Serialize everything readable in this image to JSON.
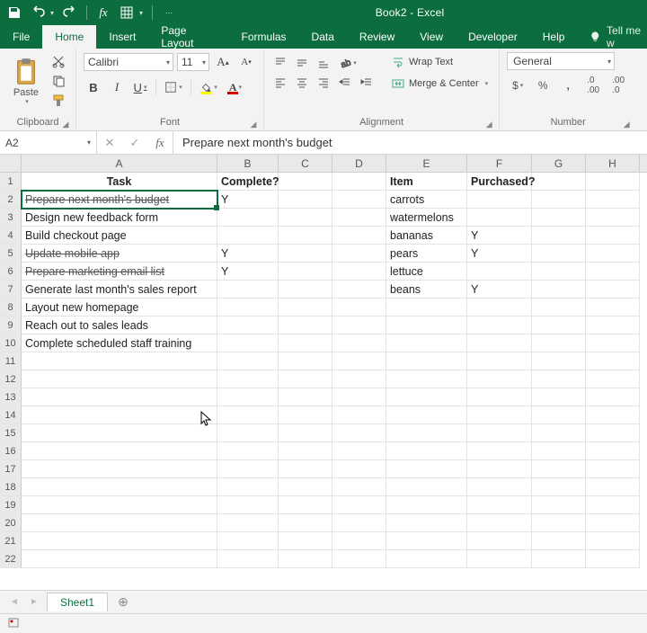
{
  "app": {
    "title": "Book2  -  Excel"
  },
  "qat_icons": [
    "save-icon",
    "undo-icon",
    "redo-icon",
    "fx-icon",
    "touch-icon"
  ],
  "tabs": [
    "File",
    "Home",
    "Insert",
    "Page Layout",
    "Formulas",
    "Data",
    "Review",
    "View",
    "Developer",
    "Help"
  ],
  "tabs_active_index": 1,
  "tellme": "Tell me w",
  "ribbon": {
    "clipboard_label": "Clipboard",
    "paste_label": "Paste",
    "font_label": "Font",
    "font_name": "Calibri",
    "font_size": "11",
    "alignment_label": "Alignment",
    "wrap_text": "Wrap Text",
    "merge_center": "Merge & Center",
    "number_label": "Number",
    "number_format": "General"
  },
  "formula_bar": {
    "name_box": "A2",
    "formula": "Prepare next month's budget"
  },
  "columns": [
    "A",
    "B",
    "C",
    "D",
    "E",
    "F",
    "G",
    "H"
  ],
  "rows": [
    1,
    2,
    3,
    4,
    5,
    6,
    7,
    8,
    9,
    10,
    11,
    12,
    13,
    14,
    15,
    16,
    17,
    18,
    19,
    20,
    21,
    22
  ],
  "cells": {
    "A1": "Task",
    "B1": "Complete?",
    "E1": "Item",
    "F1": "Purchased?",
    "A2": "Prepare next month's budget",
    "B2": "Y",
    "E2": "carrots",
    "A3": "Design new feedback form",
    "E3": "watermelons",
    "A4": "Build checkout page",
    "E4": "bananas",
    "F4": "Y",
    "A5": "Update mobile app",
    "B5": "Y",
    "E5": "pears",
    "F5": "Y",
    "A6": "Prepare marketing email list",
    "B6": "Y",
    "E6": "lettuce",
    "A7": "Generate last month's sales report",
    "E7": "beans",
    "F7": "Y",
    "A8": "Layout new homepage",
    "A9": "Reach out to sales leads",
    "A10": "Complete scheduled staff training"
  },
  "strike_cells": [
    "A2",
    "A5",
    "A6"
  ],
  "bold_cells": [
    "A1",
    "B1",
    "E1",
    "F1"
  ],
  "selected_cell": "A2",
  "sheet": {
    "name": "Sheet1"
  }
}
